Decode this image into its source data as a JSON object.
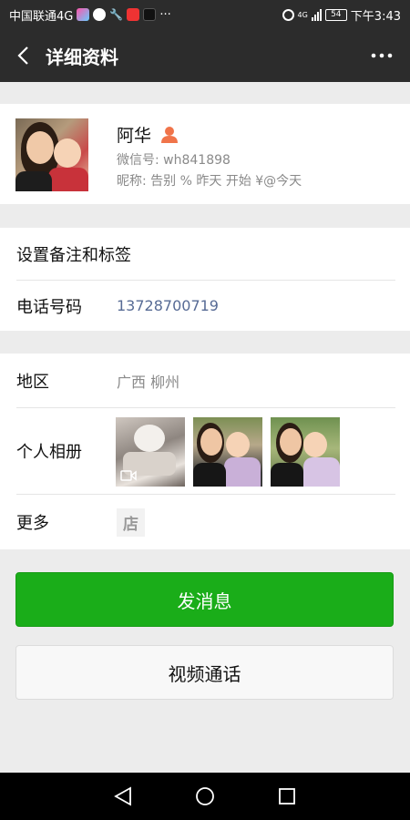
{
  "status_bar": {
    "carrier": "中国联通4G",
    "more": "···",
    "network": "4G",
    "battery": "54",
    "time": "下午3:43"
  },
  "nav": {
    "title": "详细资料"
  },
  "profile": {
    "name": "阿华",
    "wechat_id": "微信号: wh841898",
    "nickname": "昵称: 告别 % 昨天  开始 ¥@今天"
  },
  "rows": {
    "remark_label": "设置备注和标签",
    "phone_label": "电话号码",
    "phone_value": "13728700719",
    "region_label": "地区",
    "region_value": "广西  柳州",
    "album_label": "个人相册",
    "more_label": "更多",
    "shop_icon_text": "店"
  },
  "buttons": {
    "send_message": "发消息",
    "video_call": "视频通话"
  },
  "colors": {
    "primary_green": "#1aad19",
    "phone_blue": "#576b95",
    "header_bg": "#2c2c2c",
    "contact_icon": "#f0744a"
  }
}
